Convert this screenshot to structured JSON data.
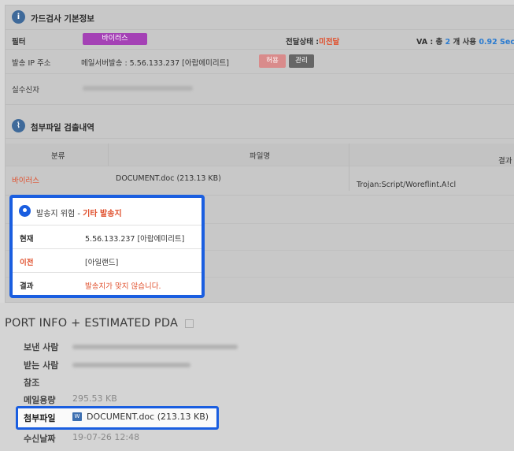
{
  "section_basic": {
    "title": "가드검사 기본정보"
  },
  "filter": {
    "label": "필터",
    "badge": "바이러스"
  },
  "delivery": {
    "label": "전달상태 :",
    "value": "미전달"
  },
  "va": {
    "prefix": "VA : 총 ",
    "count": "2",
    "middle": " 개 사용 ",
    "value": "0.92 Sec"
  },
  "sender_ip": {
    "label": "발송 IP 주소",
    "value": "메일서버발송 : 5.56.133.237 [아랍에미리트]",
    "allow_btn": "허용",
    "manage_btn": "관리"
  },
  "actual_sender": {
    "label": "실수신자"
  },
  "section_attach": {
    "title": "첨부파일 검출내역"
  },
  "attach_table": {
    "headers": [
      "분류",
      "파일명",
      "결과"
    ],
    "rows": [
      {
        "category": "바이러스",
        "filename": "DOCUMENT.doc (213.13 KB)",
        "result": "Trojan:Script/Woreflint.A!cl"
      }
    ]
  },
  "popup": {
    "title_prefix": "발송지 위험 - ",
    "title_highlight": "기타 발송지",
    "rows": [
      {
        "label": "현재",
        "value": "5.56.133.237 [아랍에미리트]"
      },
      {
        "label": "이전",
        "value": "[아일랜드]"
      },
      {
        "label": "결과",
        "value": "발송지가 맞지 않습니다."
      }
    ]
  },
  "report": {
    "title": "PORT INFO + ESTIMATED PDA",
    "sender_label": "보낸 사람",
    "recipient_label": "받는 사람",
    "cc_label": "참조",
    "size_label": "메일용량",
    "size_value": "295.53 KB",
    "attach_label": "첨부파일",
    "attach_value": "DOCUMENT.doc (213.13 KB)",
    "date_label": "수신날짜",
    "date_value": "19-07-26 12:48"
  },
  "colors": {
    "accent_blue": "#1a5ee0",
    "danger_red": "#e0502d",
    "badge_purple": "#a441b5",
    "va_blue": "#2a7bd0"
  },
  "icons": {
    "basic": "shield-icon",
    "attach": "paperclip-icon",
    "popup": "location-pin-icon",
    "report_link": "external-link-icon",
    "doc": "word-document-icon"
  }
}
